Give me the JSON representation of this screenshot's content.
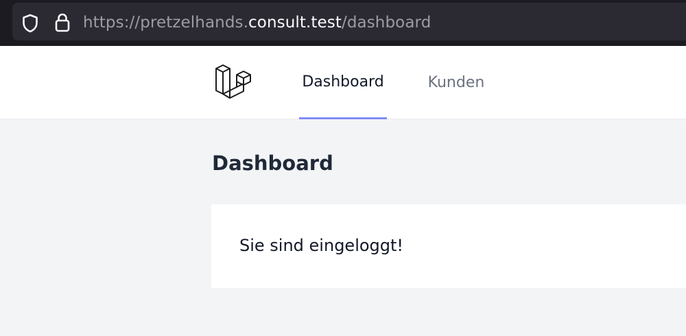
{
  "browser": {
    "url_scheme": "https://pretzelhands.",
    "url_host": "consult.test",
    "url_path": "/dashboard",
    "icons": [
      "shield-icon",
      "lock-icon"
    ]
  },
  "nav": {
    "logo_icon": "laravel-logo-icon",
    "links": [
      {
        "label": "Dashboard",
        "active": true
      },
      {
        "label": "Kunden",
        "active": false
      }
    ],
    "active_indicator_color": "#818cf8"
  },
  "page": {
    "title": "Dashboard",
    "card_message": "Sie sind eingeloggt!"
  }
}
